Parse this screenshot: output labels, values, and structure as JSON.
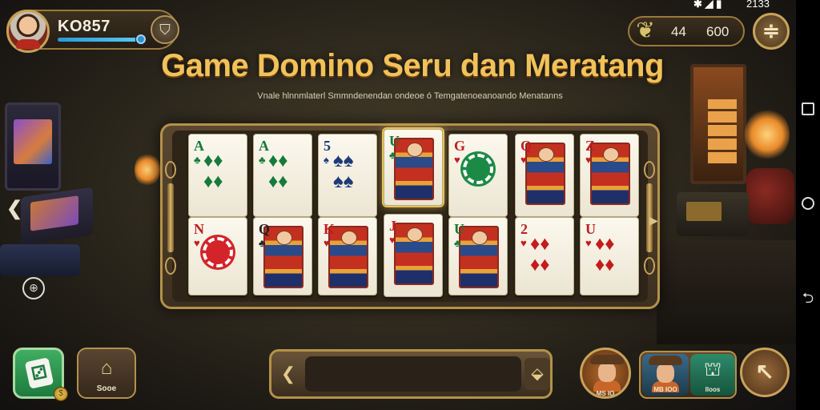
{
  "status_bar": {
    "icons": "✱ ◢ ▮",
    "time": "2133"
  },
  "player": {
    "name": "KO857",
    "xp_fraction": 0.9
  },
  "currency": {
    "icon": "leaf-icon",
    "value_a": "44",
    "value_b": "600"
  },
  "title": "Game Domino Seru dan Meratang",
  "subtitle": "Vnale hlnnmlaterl Smmndenendan ondeoe ó Temgatenoeanoando Menatanns",
  "cards": [
    {
      "top_rank": "A",
      "top_suit": "♣",
      "top_color": "grn",
      "bottom_rank": "N",
      "bottom_suit": "♥",
      "bottom_color": "red",
      "top_art": "diamond-green",
      "bottom_art": "chip-red"
    },
    {
      "top_rank": "A",
      "top_suit": "♣",
      "top_color": "grn",
      "bottom_rank": "Q",
      "bottom_suit": "♣",
      "bottom_color": "dark",
      "top_art": "diamonds-red",
      "bottom_art": "face"
    },
    {
      "top_rank": "5",
      "top_suit": "♠",
      "top_color": "blk",
      "bottom_rank": "K",
      "bottom_suit": "♥",
      "bottom_color": "red",
      "top_art": "spades",
      "bottom_art": "face"
    },
    {
      "top_rank": "U",
      "top_suit": "♣",
      "top_color": "grn",
      "bottom_rank": "J",
      "bottom_suit": "♥",
      "bottom_color": "red",
      "top_art": "jester",
      "bottom_art": "face"
    },
    {
      "top_rank": "G",
      "top_suit": "♥",
      "top_color": "red",
      "bottom_rank": "U",
      "bottom_suit": "♣",
      "bottom_color": "grn",
      "top_art": "chip-green",
      "bottom_art": "face"
    },
    {
      "top_rank": "Q",
      "top_suit": "♥",
      "top_color": "red",
      "bottom_rank": "2",
      "bottom_suit": "♥",
      "bottom_color": "red",
      "top_art": "face",
      "bottom_art": "diamonds"
    },
    {
      "top_rank": "Z",
      "top_suit": "♥",
      "top_color": "red",
      "bottom_rank": "U",
      "bottom_suit": "♥",
      "bottom_color": "red",
      "top_art": "face",
      "bottom_art": "diamonds"
    }
  ],
  "bottom": {
    "shop_label": "Sooe",
    "hero_label": "MS IO",
    "group_left_label": "MB IOO",
    "group_right_label": "Iloos"
  }
}
